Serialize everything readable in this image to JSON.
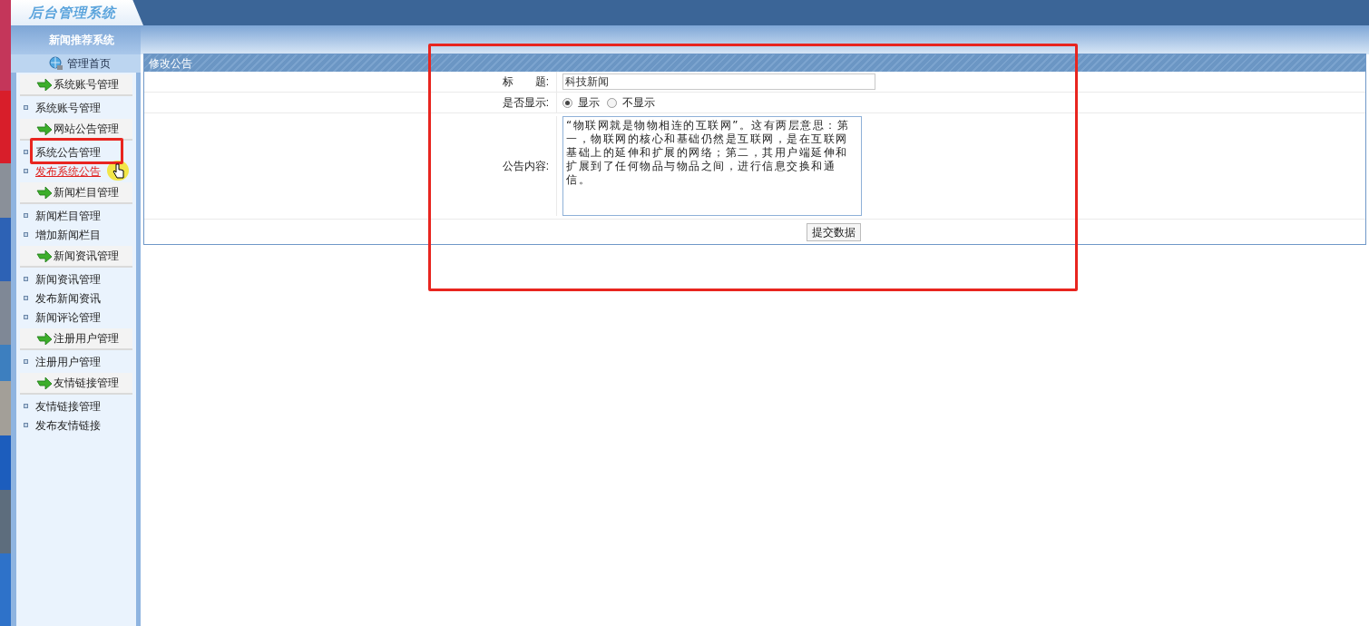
{
  "header": {
    "title": "后台管理系统",
    "subtitle": "新闻推荐系统"
  },
  "sidebar": {
    "home": "管理首页",
    "groups": [
      {
        "title": "系统账号管理",
        "items": [
          {
            "label": "系统账号管理",
            "hovered": false
          }
        ]
      },
      {
        "title": "网站公告管理",
        "items": [
          {
            "label": "系统公告管理",
            "hovered": false
          },
          {
            "label": "发布系统公告",
            "hovered": true
          }
        ]
      },
      {
        "title": "新闻栏目管理",
        "items": [
          {
            "label": "新闻栏目管理",
            "hovered": false
          },
          {
            "label": "增加新闻栏目",
            "hovered": false
          }
        ]
      },
      {
        "title": "新闻资讯管理",
        "items": [
          {
            "label": "新闻资讯管理",
            "hovered": false
          },
          {
            "label": "发布新闻资讯",
            "hovered": false
          },
          {
            "label": "新闻评论管理",
            "hovered": false
          }
        ]
      },
      {
        "title": "注册用户管理",
        "items": [
          {
            "label": "注册用户管理",
            "hovered": false
          }
        ]
      },
      {
        "title": "友情链接管理",
        "items": [
          {
            "label": "友情链接管理",
            "hovered": false
          },
          {
            "label": "发布友情链接",
            "hovered": false
          }
        ]
      }
    ]
  },
  "panel": {
    "title": "修改公告",
    "fields": [
      {
        "kind": "text",
        "label": "标　　题:",
        "value": "科技新闻"
      },
      {
        "kind": "radio",
        "label": "是否显示:",
        "options": [
          {
            "label": "显示",
            "selected": true
          },
          {
            "label": "不显示",
            "selected": false
          }
        ]
      },
      {
        "kind": "textarea",
        "label": "公告内容:",
        "value": "“物联网就是物物相连的互联网”。这有两层意思：第一，物联网的核心和基础仍然是互联网，是在互联网基础上的延伸和扩展的网络；第二，其用户端延伸和扩展到了任何物品与物品之间，进行信息交换和通信。"
      }
    ],
    "submit": "提交数据"
  }
}
